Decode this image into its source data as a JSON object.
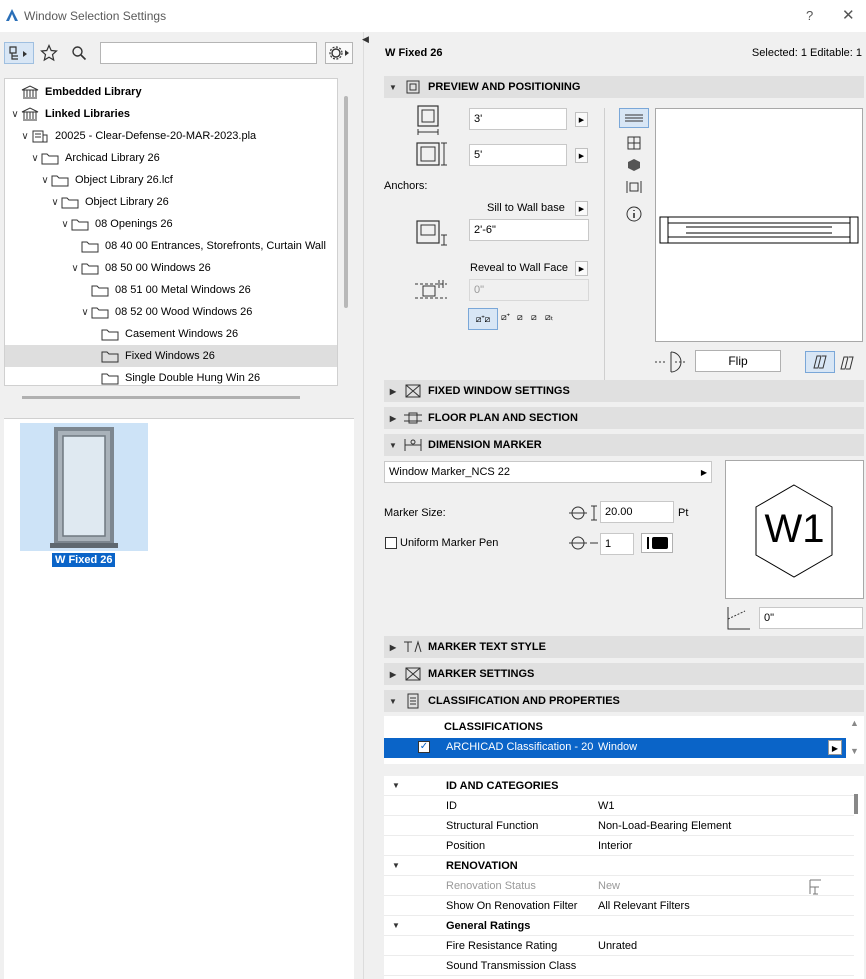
{
  "window": {
    "title": "Window Selection Settings",
    "help": "?",
    "close": "✕"
  },
  "left": {
    "search": {
      "value": "",
      "placeholder": ""
    },
    "tree": [
      {
        "label": "Embedded Library",
        "bold": true,
        "depth": 0,
        "chev": "",
        "icon": "library-icon"
      },
      {
        "label": "Linked Libraries",
        "bold": true,
        "depth": 0,
        "chev": "∨",
        "icon": "library-icon"
      },
      {
        "label": "20025 - Clear-Defense-20-MAR-2023.pla",
        "bold": false,
        "depth": 1,
        "chev": "∨",
        "icon": "archive-icon"
      },
      {
        "label": "Archicad Library 26",
        "bold": false,
        "depth": 2,
        "chev": "∨",
        "icon": "folder-icon"
      },
      {
        "label": "Object Library 26.lcf",
        "bold": false,
        "depth": 3,
        "chev": "∨",
        "icon": "folder-icon"
      },
      {
        "label": "Object Library 26",
        "bold": false,
        "depth": 4,
        "chev": "∨",
        "icon": "folder-icon"
      },
      {
        "label": "08 Openings 26",
        "bold": false,
        "depth": 5,
        "chev": "∨",
        "icon": "folder-icon"
      },
      {
        "label": "08 40 00 Entrances, Storefronts, Curtain Wall",
        "bold": false,
        "depth": 6,
        "chev": "",
        "icon": "folder-icon"
      },
      {
        "label": "08 50 00 Windows 26",
        "bold": false,
        "depth": 6,
        "chev": "∨",
        "icon": "folder-icon"
      },
      {
        "label": "08 51 00 Metal Windows 26",
        "bold": false,
        "depth": 7,
        "chev": "",
        "icon": "folder-icon"
      },
      {
        "label": "08 52 00 Wood Windows 26",
        "bold": false,
        "depth": 7,
        "chev": "∨",
        "icon": "folder-icon"
      },
      {
        "label": "Casement Windows 26",
        "bold": false,
        "depth": 8,
        "chev": "",
        "icon": "folder-icon"
      },
      {
        "label": "Fixed Windows 26",
        "bold": false,
        "depth": 8,
        "chev": "",
        "icon": "folder-icon",
        "selected": true
      },
      {
        "label": "Single Double Hung Win 26",
        "bold": false,
        "depth": 8,
        "chev": "",
        "icon": "folder-icon"
      }
    ],
    "thumbnail_label": "W Fixed 26"
  },
  "right": {
    "object_name": "W Fixed 26",
    "selection_info": "Selected: 1 Editable: 1",
    "sections": {
      "preview": "PREVIEW AND POSITIONING",
      "fixed": "FIXED WINDOW SETTINGS",
      "floor": "FLOOR PLAN AND SECTION",
      "dimension": "DIMENSION MARKER",
      "text_style": "MARKER TEXT STYLE",
      "marker_settings": "MARKER SETTINGS",
      "classification": "CLASSIFICATION AND PROPERTIES"
    },
    "width": "3'",
    "height": "5'",
    "anchors_label": "Anchors:",
    "sill_anchor": "Sill to Wall base",
    "sill_height": "2'-6\"",
    "reveal_anchor": "Reveal to Wall Face",
    "reveal_depth": "0\"",
    "flip_label": "Flip",
    "marker_type": "Window Marker_NCS 22",
    "marker_size_label": "Marker Size:",
    "marker_size": "20.00",
    "marker_size_unit": "Pt",
    "uniform_pen_label": "Uniform Marker Pen",
    "pen_number": "1",
    "marker_text": "W1",
    "marker_angle": "0\"",
    "classifications_header": "CLASSIFICATIONS",
    "classification_system": "ARCHICAD Classification - 20",
    "classification_value": "Window",
    "properties": [
      {
        "key": "ID AND CATEGORIES",
        "value": "",
        "group": true
      },
      {
        "key": "ID",
        "value": "W1"
      },
      {
        "key": "Structural Function",
        "value": "Non-Load-Bearing Element"
      },
      {
        "key": "Position",
        "value": "Interior"
      },
      {
        "key": "RENOVATION",
        "value": "",
        "group": true
      },
      {
        "key": "Renovation Status",
        "value": "New",
        "disabled": true
      },
      {
        "key": "Show On Renovation Filter",
        "value": "All Relevant Filters"
      },
      {
        "key": "General Ratings",
        "value": "",
        "group": true
      },
      {
        "key": "Fire Resistance Rating",
        "value": "Unrated"
      },
      {
        "key": "Sound Transmission Class",
        "value": ""
      }
    ]
  },
  "colors": {
    "accent": "#0a64c8",
    "header_bg": "#e0e0e0",
    "selected_row": "#dedede"
  }
}
